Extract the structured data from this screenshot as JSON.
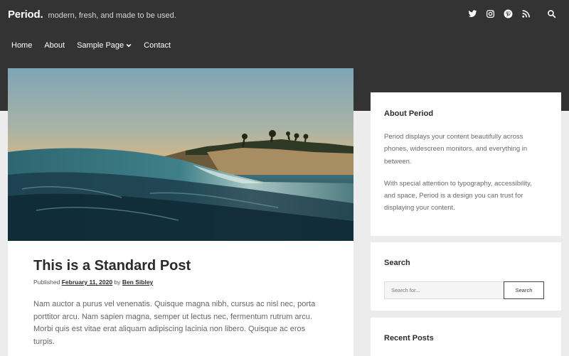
{
  "site": {
    "logo": "Period.",
    "tagline": "modern, fresh, and made to be used."
  },
  "social": [
    {
      "name": "twitter",
      "icon": "twitter-icon"
    },
    {
      "name": "instagram",
      "icon": "instagram-icon"
    },
    {
      "name": "pinterest",
      "icon": "pinterest-icon"
    },
    {
      "name": "rss",
      "icon": "rss-icon"
    }
  ],
  "nav": {
    "items": [
      "Home",
      "About",
      "Sample Page",
      "Contact"
    ]
  },
  "post": {
    "title": "This is a Standard Post",
    "published_label": "Published",
    "date": "February 11, 2020",
    "by_label": "by",
    "author": "Ben Sibley",
    "excerpt": "Nam auctor a purus vel venenatis. Quisque magna nibh, cursus ac nisl nec, porta porttitor arcu. Nam sapien magna, semper ut lectus nec, fermentum rutrum arcu. Morbi quis est vitae erat aliquam adipiscing lacinia non libero. Quisque ac eros turpis."
  },
  "widgets": {
    "about": {
      "title": "About Period",
      "p1": "Period displays your content beautifully across phones, widescreen monitors, and everything in between.",
      "p2": "With special attention to typography, accessibility, and space, Period is a design you can trust for displaying your content."
    },
    "search": {
      "title": "Search",
      "placeholder": "Search for...",
      "button": "Search"
    },
    "recent": {
      "title": "Recent Posts"
    }
  },
  "colors": {
    "header_bg": "#333333",
    "page_bg": "#ececec",
    "text_dark": "#2b2b2b"
  }
}
